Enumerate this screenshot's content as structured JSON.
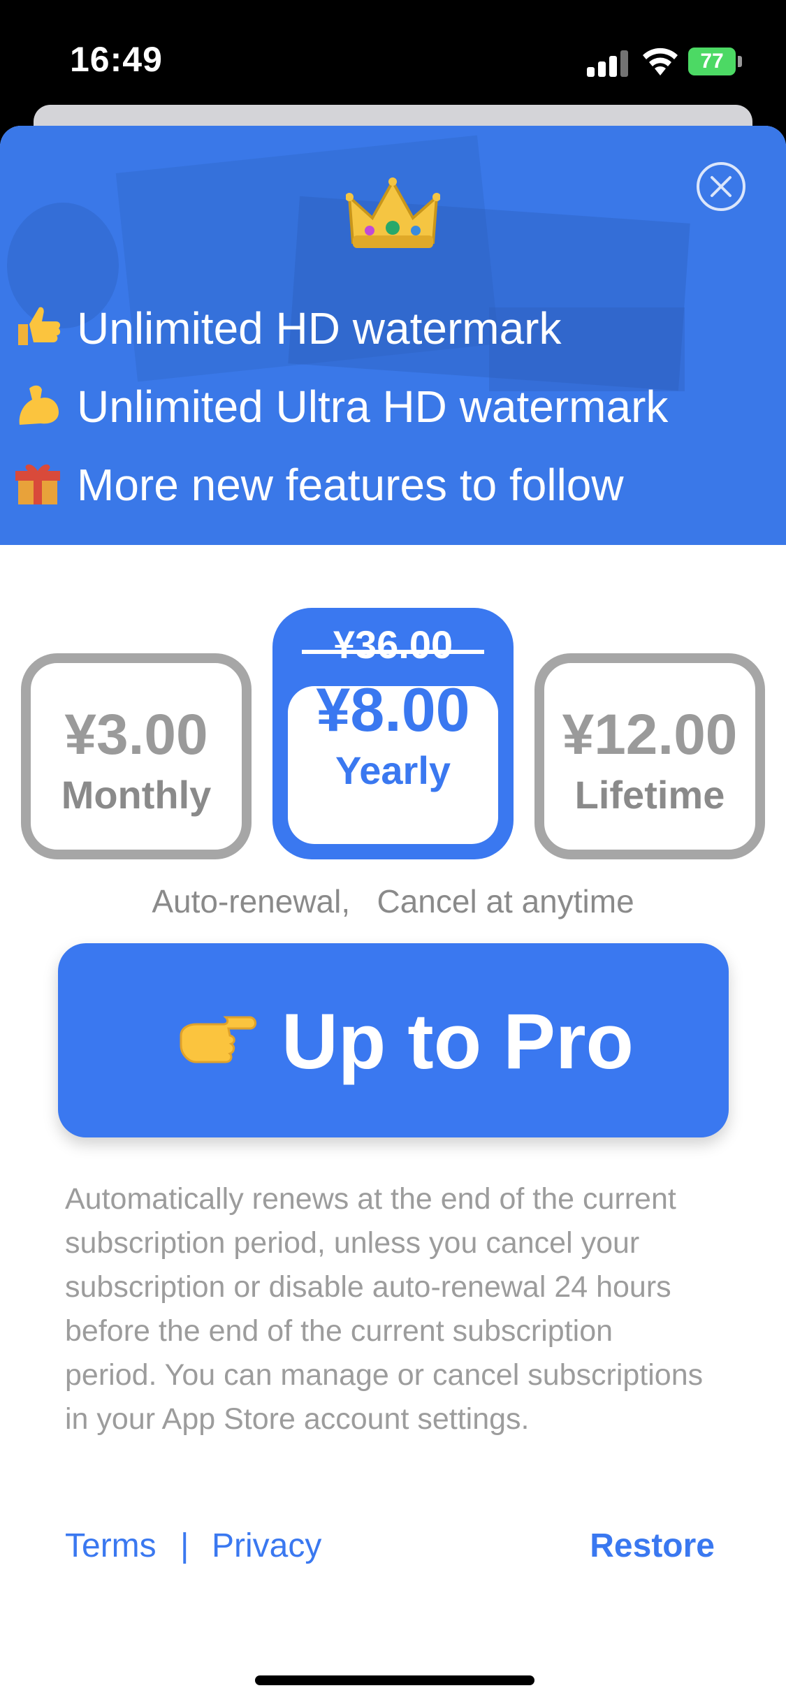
{
  "status_bar": {
    "time": "16:49",
    "battery": "77"
  },
  "hero": {
    "features": [
      {
        "icon": "thumbs-up-icon",
        "text": "Unlimited HD watermark"
      },
      {
        "icon": "flexed-biceps-icon",
        "text": "Unlimited Ultra HD watermark"
      },
      {
        "icon": "gift-icon",
        "text": "More new features to follow"
      }
    ]
  },
  "plans": {
    "monthly": {
      "price": "¥3.00",
      "label": "Monthly"
    },
    "yearly": {
      "original_price": "¥36.00",
      "price": "¥8.00",
      "label": "Yearly",
      "selected": true
    },
    "lifetime": {
      "price": "¥12.00",
      "label": "Lifetime"
    }
  },
  "autorenew_note": "Auto-renewal,   Cancel at anytime",
  "cta": {
    "label": "Up to Pro",
    "icon": "pointing-right-icon"
  },
  "disclaimer": "Automatically renews at the end of the current subscription period, unless you cancel your subscription or disable auto-renewal 24 hours before the end of the current subscription period. You can manage or cancel subscriptions in your App Store account settings.",
  "footer": {
    "terms": "Terms",
    "separator": "|",
    "privacy": "Privacy",
    "restore": "Restore"
  },
  "colors": {
    "accent": "#3a78f0",
    "hero_bg": "#3d7ae6",
    "muted_text": "#9c9c9c",
    "plan_border": "#a6a6a6"
  }
}
